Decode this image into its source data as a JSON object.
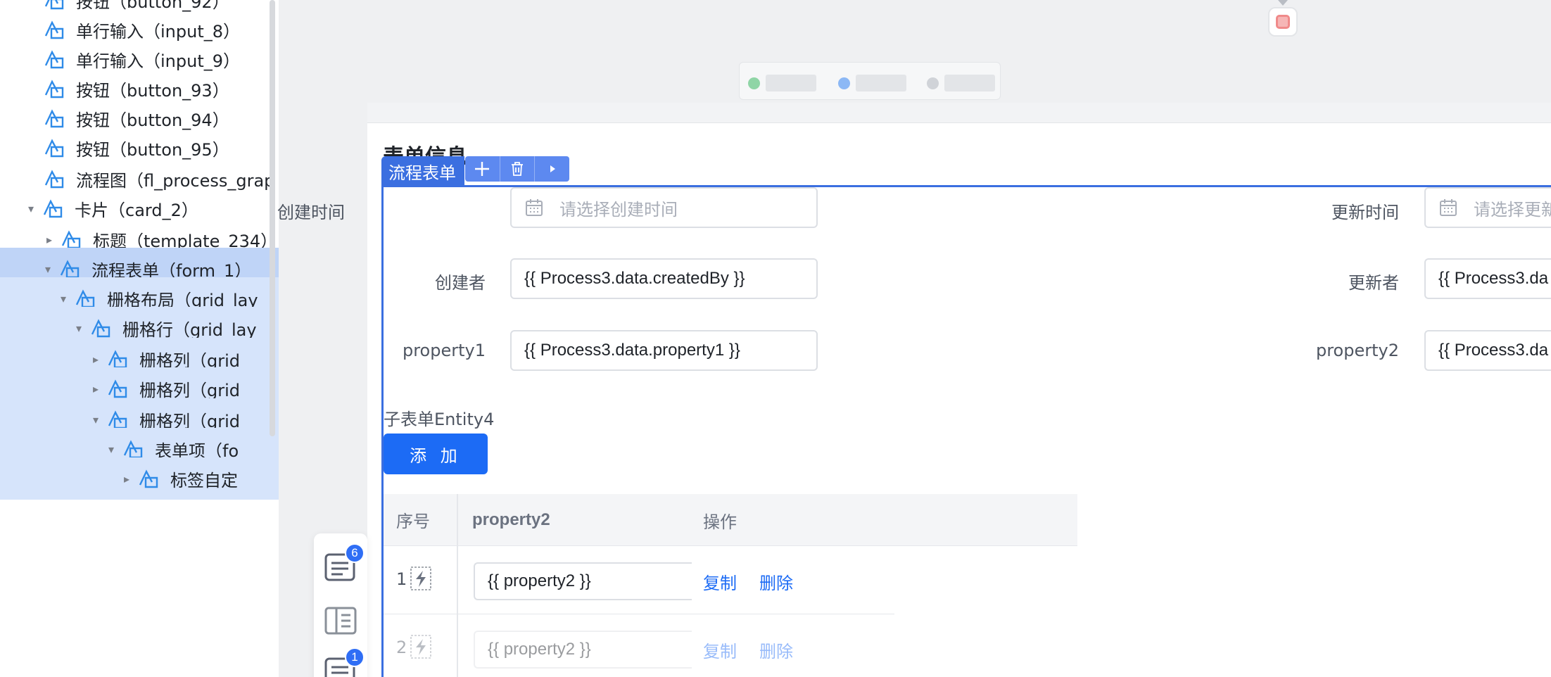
{
  "tree": {
    "items": [
      {
        "label": "按钮（button_92）",
        "expanded": null
      },
      {
        "label": "单行输入（input_8）",
        "expanded": null
      },
      {
        "label": "单行输入（input_9）",
        "expanded": null
      },
      {
        "label": "按钮（button_93）",
        "expanded": null
      },
      {
        "label": "按钮（button_94）",
        "expanded": null
      },
      {
        "label": "按钮（button_95）",
        "expanded": null
      },
      {
        "label": "流程图（fl_process_grap",
        "expanded": null
      },
      {
        "label": "卡片（card_2）",
        "expanded": true
      },
      {
        "label": "标题（template_234）",
        "expanded": false
      },
      {
        "label": "流程表单（form_1）",
        "expanded": true
      },
      {
        "label": "栅格布局（grid_lay",
        "expanded": true
      },
      {
        "label": "栅格行（grid_lay",
        "expanded": true
      },
      {
        "label": "栅格列（grid_",
        "expanded": false
      },
      {
        "label": "栅格列（grid_",
        "expanded": false
      },
      {
        "label": "栅格列（grid_",
        "expanded": true
      },
      {
        "label": "表单项（fo",
        "expanded": true
      },
      {
        "label": "标签自定",
        "expanded": false
      }
    ]
  },
  "side_tools": {
    "badge_1": "6",
    "badge_2": "1"
  },
  "canvas": {
    "card_title": "表单信息",
    "selection": {
      "label": "流程表单"
    },
    "form": {
      "created_time": {
        "label": "创建时间",
        "placeholder": "请选择创建时间"
      },
      "updated_time": {
        "label": "更新时间",
        "placeholder": "请选择更新"
      },
      "created_by": {
        "label": "创建者",
        "value": "{{ Process3.data.createdBy }}"
      },
      "updated_by": {
        "label": "更新者",
        "value": "{{ Process3.da"
      },
      "property1": {
        "label": "property1",
        "value": "{{ Process3.data.property1 }}"
      },
      "property2": {
        "label": "property2",
        "value": "{{ Process3.da"
      }
    },
    "subform": {
      "title": "子表单Entity4",
      "add_label": "添 加",
      "columns": [
        "序号",
        "property2",
        "操作"
      ],
      "rows": [
        {
          "index": "1",
          "value": "{{ property2 }}",
          "copy": "复制",
          "delete": "删除"
        },
        {
          "index": "2",
          "value": "{{ property2 }}",
          "copy": "复制",
          "delete": "删除"
        }
      ]
    }
  },
  "colors": {
    "accent": "#3b6fe0",
    "primary_button": "#1c6bf5",
    "tree_selected": "#bfd4f7",
    "legend_green": "#8fd5a6",
    "legend_blue": "#8cb8f5",
    "legend_gray": "#d0d3d8"
  }
}
